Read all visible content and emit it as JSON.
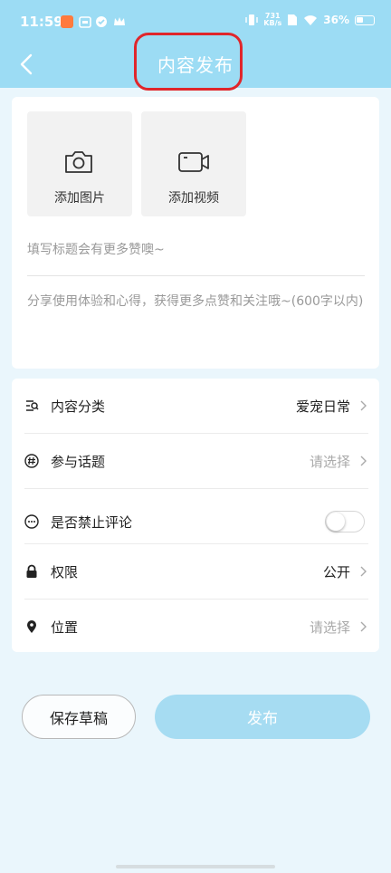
{
  "status_bar": {
    "time": "11:59",
    "net_speed_value": "731",
    "net_speed_unit": "KB/s",
    "battery": "36%"
  },
  "header": {
    "title": "内容发布",
    "back_icon": "chevron-left-icon",
    "accent_color": "#9cdcf4",
    "highlight_color": "#e0262b"
  },
  "media": {
    "add_image": {
      "label": "添加图片",
      "icon": "camera-icon"
    },
    "add_video": {
      "label": "添加视频",
      "icon": "video-camera-icon"
    }
  },
  "editor": {
    "title_placeholder": "填写标题会有更多赞噢~",
    "body_placeholder": "分享使用体验和心得，获得更多点赞和关注哦~(600字以内)"
  },
  "settings": {
    "category": {
      "label": "内容分类",
      "value": "爱宠日常",
      "icon": "category-icon"
    },
    "topic": {
      "label": "参与话题",
      "value": "请选择",
      "icon": "hashtag-icon"
    },
    "disable_comments": {
      "label": "是否禁止评论",
      "enabled": false,
      "icon": "comment-icon"
    },
    "permission": {
      "label": "权限",
      "value": "公开",
      "icon": "lock-icon"
    },
    "location": {
      "label": "位置",
      "value": "请选择",
      "icon": "location-pin-icon"
    }
  },
  "actions": {
    "save_draft": "保存草稿",
    "publish": "发布"
  }
}
